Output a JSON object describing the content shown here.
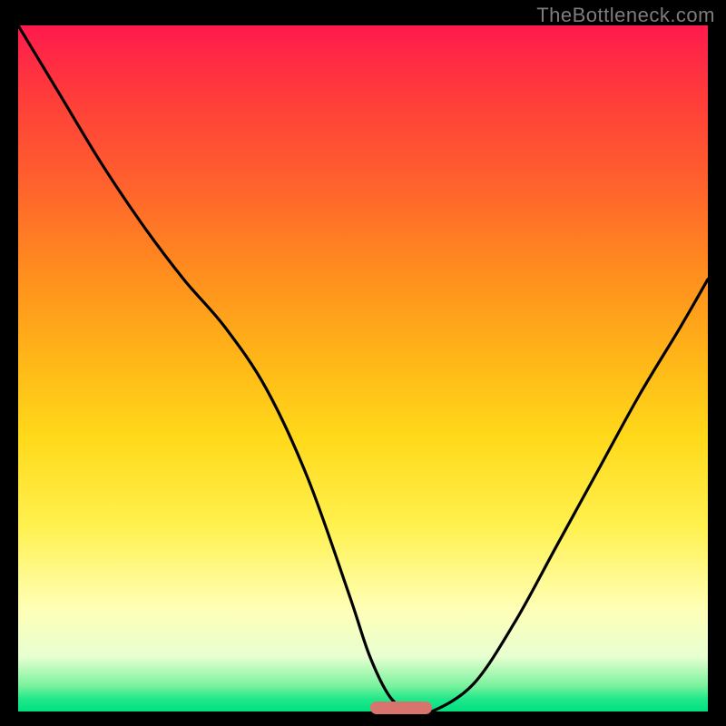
{
  "watermark": "TheBottleneck.com",
  "colors": {
    "background": "#000000",
    "curve_stroke": "#000000",
    "min_bar": "#d9736e",
    "watermark": "#7d7d7d"
  },
  "chart_data": {
    "type": "line",
    "title": "",
    "xlabel": "",
    "ylabel": "",
    "xlim": [
      0,
      100
    ],
    "ylim": [
      0,
      100
    ],
    "grid": false,
    "series": [
      {
        "name": "bottleneck-curve",
        "x": [
          0,
          6,
          12,
          18,
          24,
          30,
          36,
          42,
          48,
          51,
          54,
          57,
          60,
          66,
          72,
          78,
          84,
          90,
          96,
          100
        ],
        "values": [
          100,
          90,
          80,
          71,
          63,
          56,
          47,
          34,
          17,
          8,
          2,
          0,
          0,
          4,
          13,
          24,
          35,
          46,
          56,
          63
        ]
      }
    ],
    "annotations": [
      {
        "name": "optimal-range-bar",
        "x_start": 51,
        "x_end": 60,
        "y": 0
      }
    ]
  }
}
